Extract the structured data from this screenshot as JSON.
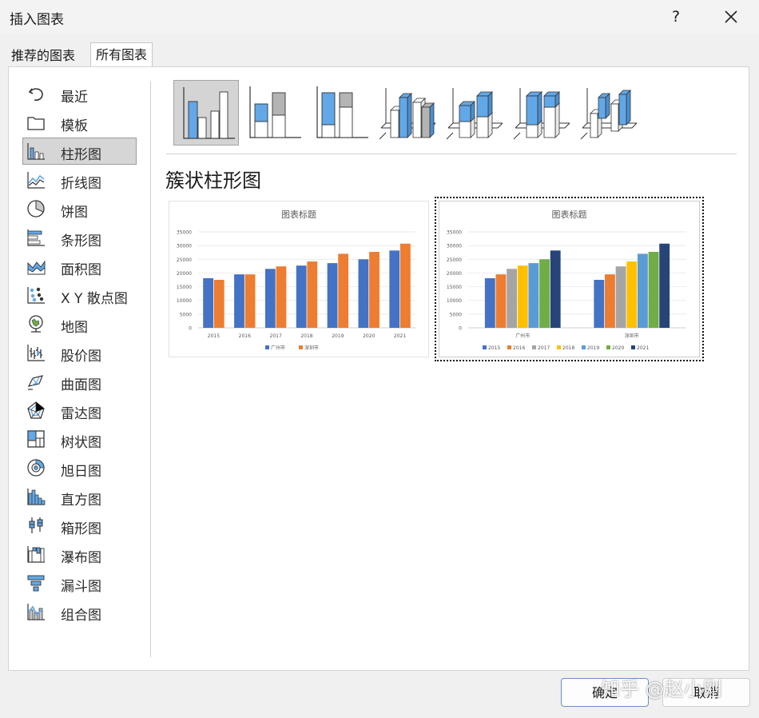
{
  "window": {
    "title": "插入图表",
    "help_label": "?"
  },
  "tabs": [
    {
      "label": "推荐的图表"
    },
    {
      "label": "所有图表"
    }
  ],
  "sidebar": {
    "items": [
      {
        "label": "最近",
        "icon": "recent-icon"
      },
      {
        "label": "模板",
        "icon": "folder-icon"
      },
      {
        "label": "柱形图",
        "icon": "column-chart-icon",
        "selected": true
      },
      {
        "label": "折线图",
        "icon": "line-chart-icon"
      },
      {
        "label": "饼图",
        "icon": "pie-chart-icon"
      },
      {
        "label": "条形图",
        "icon": "bar-chart-icon"
      },
      {
        "label": "面积图",
        "icon": "area-chart-icon"
      },
      {
        "label": "X Y 散点图",
        "icon": "scatter-chart-icon"
      },
      {
        "label": "地图",
        "icon": "map-chart-icon"
      },
      {
        "label": "股价图",
        "icon": "stock-chart-icon"
      },
      {
        "label": "曲面图",
        "icon": "surface-chart-icon"
      },
      {
        "label": "雷达图",
        "icon": "radar-chart-icon"
      },
      {
        "label": "树状图",
        "icon": "treemap-chart-icon"
      },
      {
        "label": "旭日图",
        "icon": "sunburst-chart-icon"
      },
      {
        "label": "直方图",
        "icon": "histogram-chart-icon"
      },
      {
        "label": "箱形图",
        "icon": "box-whisker-chart-icon"
      },
      {
        "label": "瀑布图",
        "icon": "waterfall-chart-icon"
      },
      {
        "label": "漏斗图",
        "icon": "funnel-chart-icon"
      },
      {
        "label": "组合图",
        "icon": "combo-chart-icon"
      }
    ]
  },
  "subtypes": [
    {
      "icon": "clustered-column-icon",
      "selected": true
    },
    {
      "icon": "stacked-column-icon"
    },
    {
      "icon": "percent-stacked-column-icon"
    },
    {
      "icon": "3d-clustered-column-icon"
    },
    {
      "icon": "3d-stacked-column-icon"
    },
    {
      "icon": "3d-percent-stacked-column-icon"
    },
    {
      "icon": "3d-column-icon"
    }
  ],
  "subtype_title": "簇状柱形图",
  "colors": {
    "accent_blue": "#4472c4",
    "orange": "#ed7d31",
    "gray": "#a5a5a5",
    "gold": "#ffc000",
    "light_blue": "#5b9bd5",
    "green": "#70ad47",
    "navy": "#264478",
    "icon_blue": "#62a8e8"
  },
  "chart_data": [
    {
      "type": "bar",
      "title": "图表标题",
      "categories": [
        "2015",
        "2016",
        "2017",
        "2018",
        "2019",
        "2020",
        "2021"
      ],
      "series": [
        {
          "name": "广州市",
          "color": "#4472c4",
          "values": [
            18100,
            19500,
            21500,
            22700,
            23600,
            25000,
            28200
          ]
        },
        {
          "name": "深圳市",
          "color": "#ed7d31",
          "values": [
            17500,
            19500,
            22400,
            24200,
            27000,
            27700,
            30700
          ]
        }
      ],
      "ylim": [
        0,
        35000
      ],
      "yticks": [
        0,
        5000,
        10000,
        15000,
        20000,
        25000,
        30000,
        35000
      ],
      "grid": true,
      "legend": "bottom"
    },
    {
      "type": "bar",
      "title": "图表标题",
      "categories": [
        "广州市",
        "深圳市"
      ],
      "series": [
        {
          "name": "2015",
          "color": "#4472c4",
          "values": [
            18100,
            17500
          ]
        },
        {
          "name": "2016",
          "color": "#ed7d31",
          "values": [
            19500,
            19500
          ]
        },
        {
          "name": "2017",
          "color": "#a5a5a5",
          "values": [
            21500,
            22400
          ]
        },
        {
          "name": "2018",
          "color": "#ffc000",
          "values": [
            22700,
            24200
          ]
        },
        {
          "name": "2019",
          "color": "#5b9bd5",
          "values": [
            23600,
            27000
          ]
        },
        {
          "name": "2020",
          "color": "#70ad47",
          "values": [
            25000,
            27700
          ]
        },
        {
          "name": "2021",
          "color": "#264478",
          "values": [
            28200,
            30700
          ]
        }
      ],
      "ylim": [
        0,
        35000
      ],
      "yticks": [
        0,
        5000,
        10000,
        15000,
        20000,
        25000,
        30000,
        35000
      ],
      "grid": true,
      "legend": "bottom"
    }
  ],
  "buttons": {
    "ok_label": "确定",
    "cancel_label": "取消"
  },
  "watermark": {
    "text": "知乎 @赵小刚"
  }
}
